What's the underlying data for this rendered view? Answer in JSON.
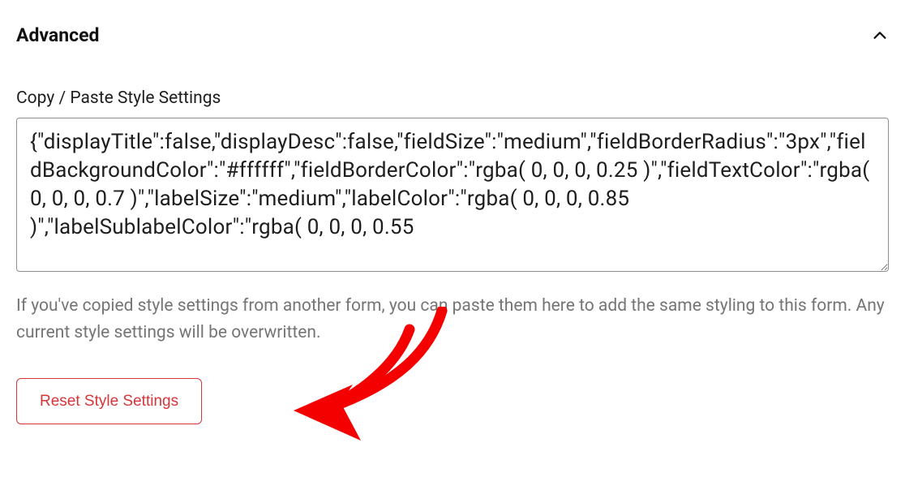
{
  "section": {
    "title": "Advanced",
    "expanded": true
  },
  "copyPaste": {
    "label": "Copy / Paste Style Settings",
    "value": "{\"displayTitle\":false,\"displayDesc\":false,\"fieldSize\":\"medium\",\"fieldBorderRadius\":\"3px\",\"fieldBackgroundColor\":\"#ffffff\",\"fieldBorderColor\":\"rgba( 0, 0, 0, 0.25 )\",\"fieldTextColor\":\"rgba( 0, 0, 0, 0.7 )\",\"labelSize\":\"medium\",\"labelColor\":\"rgba( 0, 0, 0, 0.85 )\",\"labelSublabelColor\":\"rgba( 0, 0, 0, 0.55",
    "help": "If you've copied style settings from another form, you can paste them here to add the same styling to this form. Any current style settings will be overwritten."
  },
  "reset": {
    "label": "Reset Style Settings"
  },
  "colors": {
    "danger": "#d63638",
    "helpText": "#757575",
    "border": "#8c8f94",
    "annotation": "#f40000"
  }
}
